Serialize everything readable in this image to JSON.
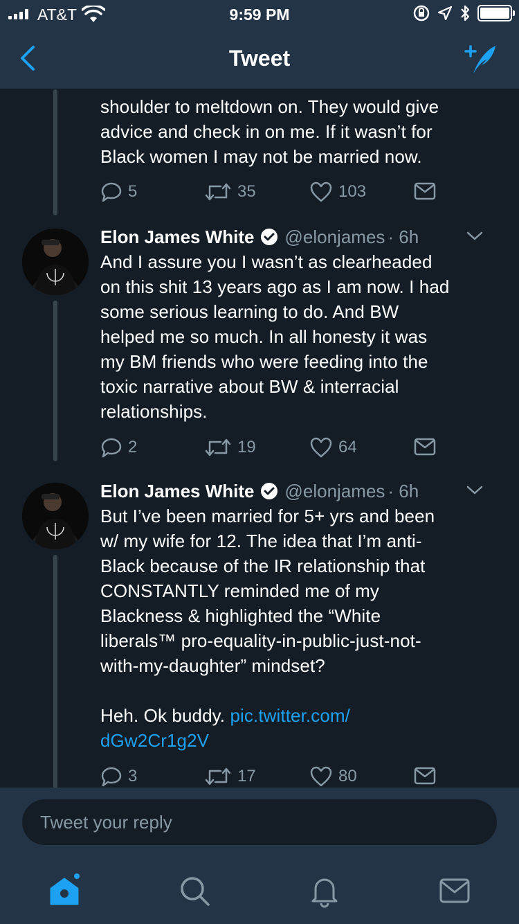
{
  "status": {
    "carrier": "AT&T",
    "time": "9:59 PM"
  },
  "nav": {
    "title": "Tweet",
    "back_icon": "chevron-left-icon",
    "compose_icon": "compose-tweet-icon"
  },
  "colors": {
    "accent": "#1da1f2",
    "background": "#141d26",
    "bar": "#243447",
    "muted": "#8899a6"
  },
  "tweets": [
    {
      "lines": [
        "shoulder to meltdown on. They would give",
        "advice and check in on me. If it wasn’t for",
        "Black women I may not be married now."
      ],
      "replies": "5",
      "retweets": "35",
      "likes": "103"
    },
    {
      "name": "Elon James White",
      "handle": "@elonjames",
      "time": "· 6h",
      "lines": [
        "And I assure you I wasn’t as clearheaded",
        "on this shit 13 years ago as I am now. I had",
        "some serious learning to do. And BW",
        "helped me so much. In all honesty it was",
        "my BM friends who were feeding into the",
        "toxic narrative about BW & interracial",
        "relationships."
      ],
      "replies": "2",
      "retweets": "19",
      "likes": "64"
    },
    {
      "name": "Elon James White",
      "handle": "@elonjames",
      "time": "· 6h",
      "lines": [
        "But I’ve been married for 5+ yrs and been",
        "w/ my wife for 12. The idea that I’m anti-",
        "Black because of the IR relationship that",
        "CONSTANTLY reminded me of my",
        "Blackness & highlighted the “White",
        "liberals™ pro-equality-in-public-just-not-",
        "with-my-daughter” mindset?"
      ],
      "tail": "Heh. Ok buddy. ",
      "link1": "pic.twitter.com/",
      "link2": "dGw2Cr1g2V",
      "replies": "3",
      "retweets": "17",
      "likes": "80"
    }
  ],
  "reply": {
    "placeholder": "Tweet your reply"
  },
  "tabs": [
    "home-icon",
    "search-icon",
    "notifications-icon",
    "messages-icon"
  ]
}
